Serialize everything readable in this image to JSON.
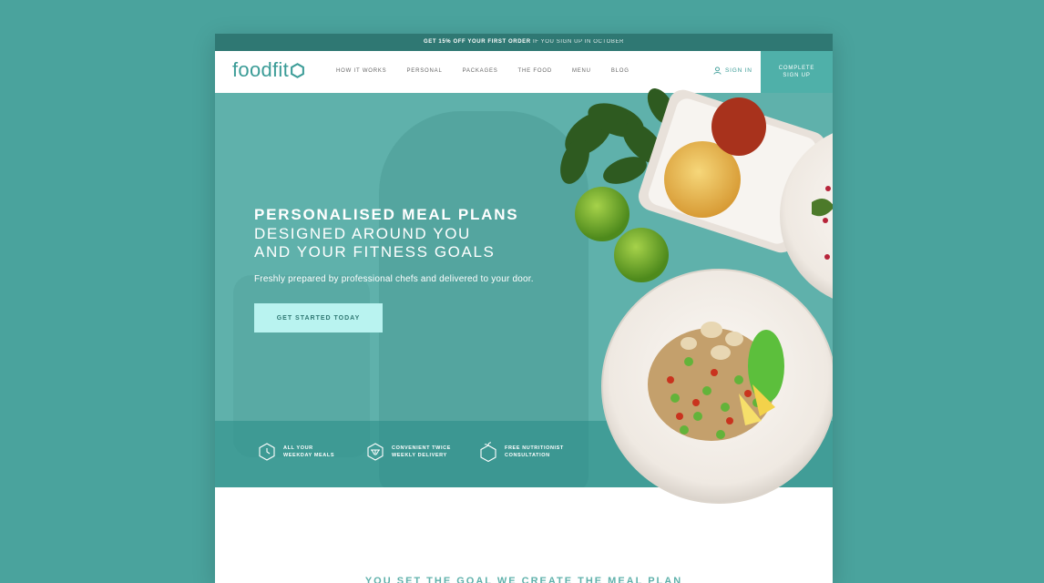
{
  "promo": {
    "bold": "GET 15% OFF YOUR FIRST ORDER",
    "rest": "IF YOU SIGN UP IN OCTOBER"
  },
  "logo": {
    "text": "foodfit"
  },
  "nav": {
    "items": [
      {
        "label": "HOW IT WORKS"
      },
      {
        "label": "PERSONAL"
      },
      {
        "label": "PACKAGES"
      },
      {
        "label": "THE FOOD"
      },
      {
        "label": "MENU"
      },
      {
        "label": "BLOG"
      }
    ],
    "signin": "SIGN IN",
    "signup_line1": "COMPLETE",
    "signup_line2": "SIGN UP"
  },
  "hero": {
    "title": "PERSONALISED MEAL PLANS",
    "subtitle_line1": "DESIGNED AROUND YOU",
    "subtitle_line2": "AND YOUR FITNESS GOALS",
    "description": "Freshly prepared by professional chefs and delivered to your door.",
    "cta": "GET STARTED TODAY"
  },
  "features": [
    {
      "line1": "ALL YOUR",
      "line2": "WEEKDAY MEALS",
      "icon": "clock-icon"
    },
    {
      "line1": "CONVENIENT TWICE",
      "line2": "WEEKLY DELIVERY",
      "icon": "delivery-icon"
    },
    {
      "line1": "FREE NUTRITIONIST",
      "line2": "CONSULTATION",
      "icon": "apple-icon"
    }
  ],
  "section": {
    "title": "YOU SET THE GOAL WE CREATE THE MEAL PLAN"
  },
  "colors": {
    "brand": "#3b9c97",
    "hero": "#5fb1ab",
    "cta": "#b9f3f0",
    "background": "#4aa39d"
  }
}
